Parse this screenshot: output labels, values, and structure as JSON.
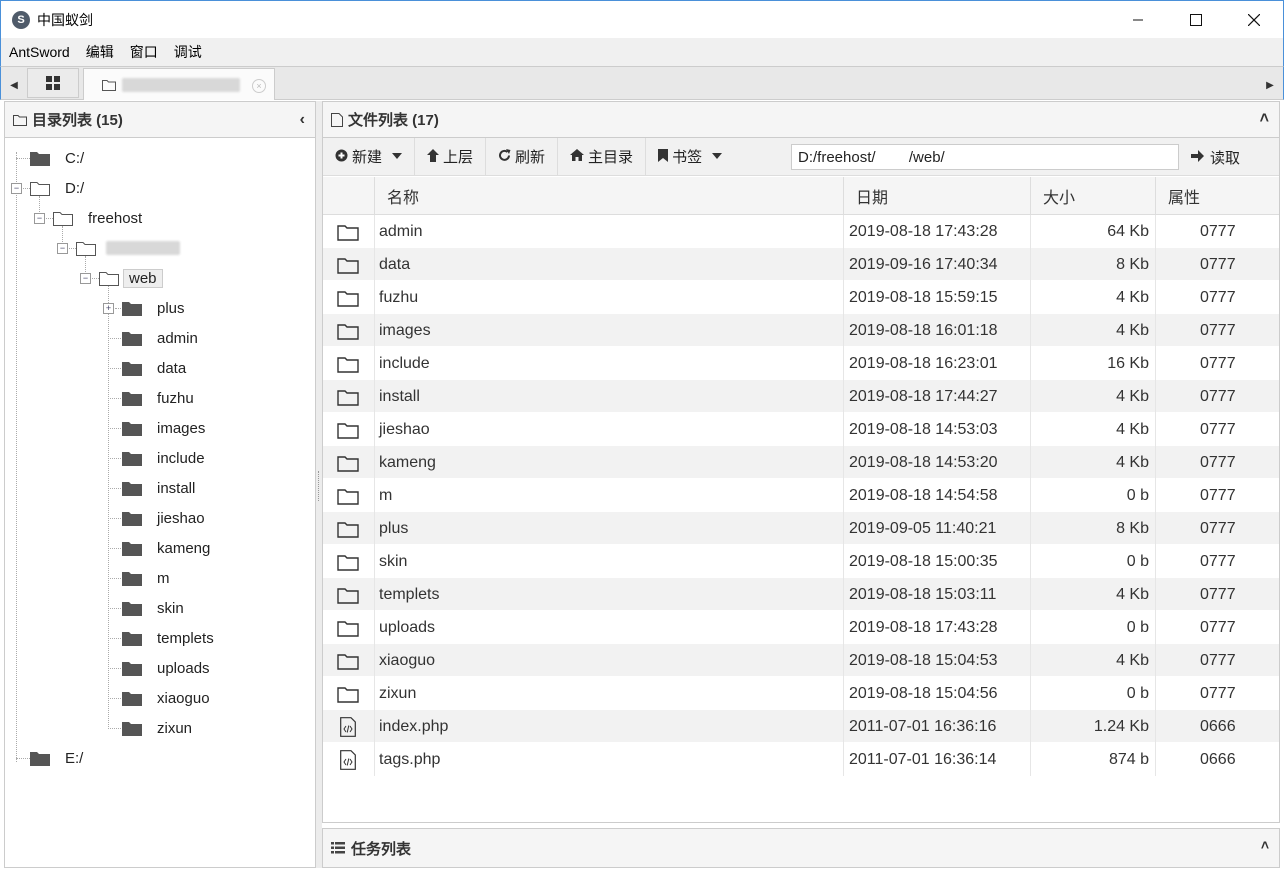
{
  "window": {
    "title": "中国蚁剑",
    "logo_letter": "S",
    "minimize": "—",
    "maximize": "☐",
    "close": "✕"
  },
  "menu": [
    "AntSword",
    "编辑",
    "窗口",
    "调试"
  ],
  "tabs": {
    "scroll_left": "◀",
    "scroll_right": "▶",
    "shell_close": "×"
  },
  "left_panel": {
    "title": "目录列表 (15)",
    "collapse": "‹",
    "tree": {
      "drives": [
        "C:/",
        "D:/",
        "E:/"
      ],
      "freehost": "freehost",
      "web": "web",
      "web_children": [
        "plus",
        "admin",
        "data",
        "fuzhu",
        "images",
        "include",
        "install",
        "jieshao",
        "kameng",
        "m",
        "skin",
        "templets",
        "uploads",
        "xiaoguo",
        "zixun"
      ]
    }
  },
  "right_panel": {
    "title": "文件列表 (17)",
    "collapse": "˄",
    "toolbar": {
      "new": "新建",
      "up": "上层",
      "refresh": "刷新",
      "home": "主目录",
      "bookmark": "书签",
      "path_value": "D:/freehost/        /web/",
      "read": "读取"
    },
    "columns": [
      "名称",
      "日期",
      "大小",
      "属性"
    ],
    "files": [
      {
        "name": "admin",
        "date": "2019-08-18 17:43:28",
        "size": "64 Kb",
        "attr": "0777",
        "type": "folder"
      },
      {
        "name": "data",
        "date": "2019-09-16 17:40:34",
        "size": "8 Kb",
        "attr": "0777",
        "type": "folder"
      },
      {
        "name": "fuzhu",
        "date": "2019-08-18 15:59:15",
        "size": "4 Kb",
        "attr": "0777",
        "type": "folder"
      },
      {
        "name": "images",
        "date": "2019-08-18 16:01:18",
        "size": "4 Kb",
        "attr": "0777",
        "type": "folder"
      },
      {
        "name": "include",
        "date": "2019-08-18 16:23:01",
        "size": "16 Kb",
        "attr": "0777",
        "type": "folder"
      },
      {
        "name": "install",
        "date": "2019-08-18 17:44:27",
        "size": "4 Kb",
        "attr": "0777",
        "type": "folder"
      },
      {
        "name": "jieshao",
        "date": "2019-08-18 14:53:03",
        "size": "4 Kb",
        "attr": "0777",
        "type": "folder"
      },
      {
        "name": "kameng",
        "date": "2019-08-18 14:53:20",
        "size": "4 Kb",
        "attr": "0777",
        "type": "folder"
      },
      {
        "name": "m",
        "date": "2019-08-18 14:54:58",
        "size": "0 b",
        "attr": "0777",
        "type": "folder"
      },
      {
        "name": "plus",
        "date": "2019-09-05 11:40:21",
        "size": "8 Kb",
        "attr": "0777",
        "type": "folder"
      },
      {
        "name": "skin",
        "date": "2019-08-18 15:00:35",
        "size": "0 b",
        "attr": "0777",
        "type": "folder"
      },
      {
        "name": "templets",
        "date": "2019-08-18 15:03:11",
        "size": "4 Kb",
        "attr": "0777",
        "type": "folder"
      },
      {
        "name": "uploads",
        "date": "2019-08-18 17:43:28",
        "size": "0 b",
        "attr": "0777",
        "type": "folder"
      },
      {
        "name": "xiaoguo",
        "date": "2019-08-18 15:04:53",
        "size": "4 Kb",
        "attr": "0777",
        "type": "folder"
      },
      {
        "name": "zixun",
        "date": "2019-08-18 15:04:56",
        "size": "0 b",
        "attr": "0777",
        "type": "folder"
      },
      {
        "name": "index.php",
        "date": "2011-07-01 16:36:16",
        "size": "1.24 Kb",
        "attr": "0666",
        "type": "php"
      },
      {
        "name": "tags.php",
        "date": "2011-07-01 16:36:14",
        "size": "874 b",
        "attr": "0666",
        "type": "php"
      }
    ]
  },
  "task_panel": {
    "title": "任务列表",
    "expand": "˄"
  }
}
